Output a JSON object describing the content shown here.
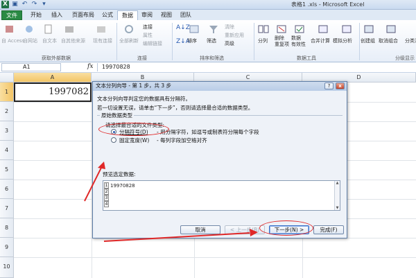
{
  "window": {
    "title": "表格1 .xls - Microsoft Excel"
  },
  "quick_access": [
    "excel-logo",
    "save-icon",
    "undo-icon",
    "redo-icon",
    "customize-icon"
  ],
  "ribbon": {
    "tabs": [
      "文件",
      "开始",
      "插入",
      "页面布局",
      "公式",
      "数据",
      "审阅",
      "视图",
      "团队"
    ],
    "active_tab": "数据",
    "groups": {
      "external_data": {
        "label": "获取外部数据",
        "items": [
          "自 Access",
          "自网站",
          "自文本",
          "自其他来源",
          "现有连接"
        ]
      },
      "connections": {
        "label": "连接",
        "items": [
          "全部刷新",
          "连接",
          "属性",
          "编辑链接"
        ]
      },
      "sort_filter": {
        "label": "排序和筛选",
        "items": [
          "排序",
          "筛选",
          "清除",
          "重新应用",
          "高级"
        ]
      },
      "data_tools": {
        "label": "数据工具",
        "items": [
          "分列",
          "删除\n重复项",
          "数据\n有效性",
          "合并计算",
          "模拟分析"
        ]
      },
      "outline": {
        "label": "分级显示",
        "items": [
          "创建组",
          "取消组合",
          "分类汇总"
        ]
      }
    }
  },
  "formula_bar": {
    "name_box": "A1",
    "fx": "fx",
    "content": "19970828"
  },
  "grid": {
    "columns": [
      "A",
      "B",
      "C",
      "D"
    ],
    "rows": [
      "1",
      "2",
      "3",
      "4",
      "5",
      "6",
      "7",
      "8",
      "9",
      "10"
    ],
    "a1_value": "1997082"
  },
  "dialog": {
    "title": "文本分列向导 - 第 1 步，共 3 步",
    "help_label": "?",
    "close_label": "x",
    "line1": "文本分列向导判定您的数据具有分隔符。",
    "line2": "若一切设置无误，请单击“下一步”，否则请选择最合适的数据类型。",
    "group_title": "原始数据类型",
    "prompt": "请选择最合适的文件类型:",
    "option_delimited": "分隔符号(D)",
    "option_delimited_desc": "- 用分隔字符，如逗号或制表符分隔每个字段",
    "option_fixed": "固定宽度(W)",
    "option_fixed_desc": "- 每列字段加空格对齐",
    "selected_option": "delimited",
    "preview_label": "预览选定数据:",
    "preview_rows": [
      {
        "num": "1",
        "text": "19970828"
      },
      {
        "num": "2",
        "text": ""
      },
      {
        "num": "3",
        "text": ""
      },
      {
        "num": "4",
        "text": ""
      }
    ],
    "buttons": {
      "cancel": "取消",
      "back": "< 上一步(B)",
      "next": "下一步(N) >",
      "finish": "完成(F)"
    }
  },
  "annotations": {
    "color": "#e02828"
  }
}
